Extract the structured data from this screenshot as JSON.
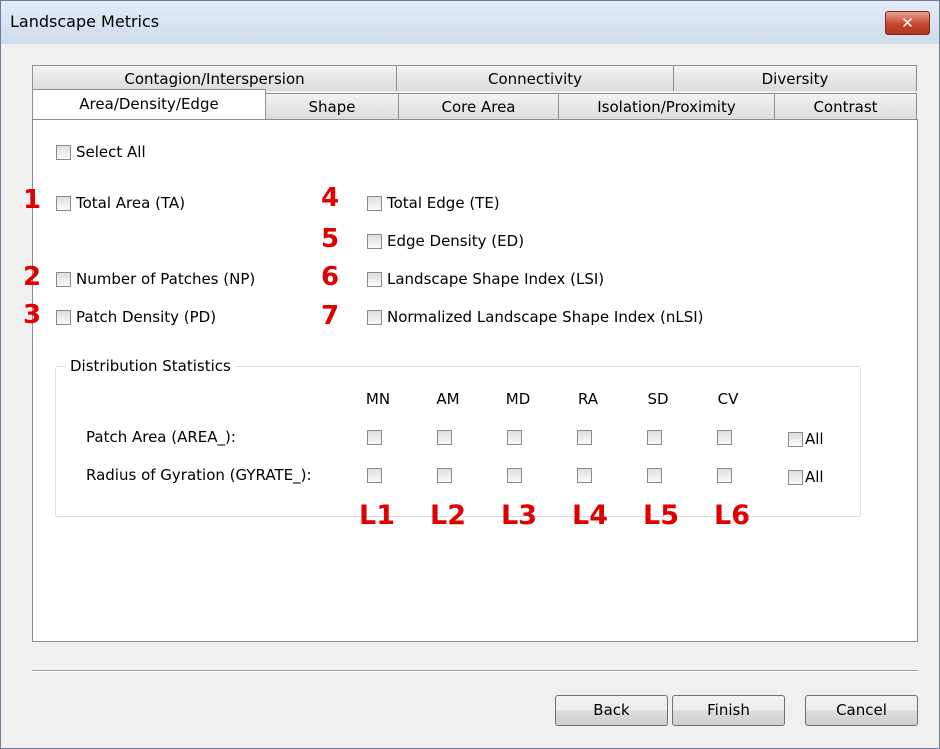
{
  "window": {
    "title": "Landscape Metrics",
    "close_glyph": "✕"
  },
  "tabs_row1": [
    "Contagion/Interspersion",
    "Connectivity",
    "Diversity"
  ],
  "tabs_row2": [
    "Area/Density/Edge",
    "Shape",
    "Core Area",
    "Isolation/Proximity",
    "Contrast"
  ],
  "active_tab": "Area/Density/Edge",
  "select_all": "Select All",
  "metrics": [
    {
      "number": "1",
      "label": "Total Area (TA)",
      "checked": false
    },
    {
      "number": "2",
      "label": "Number of Patches (NP)",
      "checked": false
    },
    {
      "number": "3",
      "label": "Patch Density (PD)",
      "checked": false
    },
    {
      "number": "4",
      "label": "Total Edge (TE)",
      "checked": false
    },
    {
      "number": "5",
      "label": "Edge Density (ED)",
      "checked": false
    },
    {
      "number": "6",
      "label": "Landscape Shape Index (LSI)",
      "checked": false
    },
    {
      "number": "7",
      "label": "Normalized Landscape Shape Index (nLSI)",
      "checked": false
    }
  ],
  "distribution": {
    "legend": "Distribution Statistics",
    "columns": [
      "MN",
      "AM",
      "MD",
      "RA",
      "SD",
      "CV"
    ],
    "rows": [
      {
        "label": "Patch Area (AREA_):",
        "all_label": "All"
      },
      {
        "label": "Radius of Gyration (GYRATE_):",
        "all_label": "All"
      }
    ],
    "column_markers": [
      "L1",
      "L2",
      "L3",
      "L4",
      "L5",
      "L6"
    ]
  },
  "buttons": {
    "back": "Back",
    "finish": "Finish",
    "cancel": "Cancel"
  }
}
